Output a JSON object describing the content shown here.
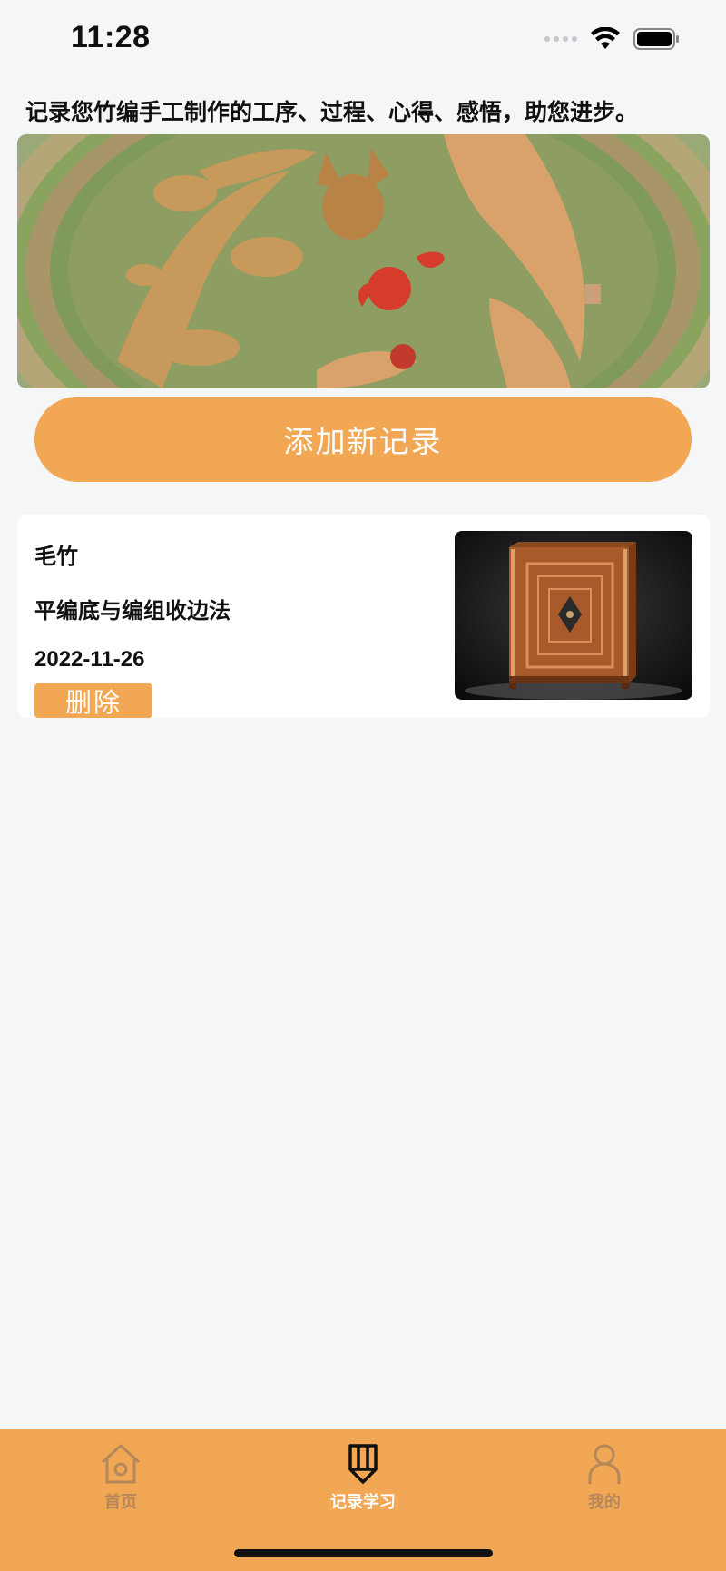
{
  "status_bar": {
    "time": "11:28"
  },
  "intro_text": "记录您竹编手工制作的工序、过程、心得、感悟，助您进步。",
  "banner": {
    "description_icon": "bamboo-dragon-phoenix-image"
  },
  "add_button_label": "添加新记录",
  "records": [
    {
      "material": "毛竹",
      "title": "平编底与编组收边法",
      "date": "2022-11-26",
      "delete_label": "删除",
      "thumbnail_icon": "bamboo-cabinet-image"
    }
  ],
  "tabs": [
    {
      "label": "首页",
      "icon": "home-icon",
      "active": false
    },
    {
      "label": "记录学习",
      "icon": "pencil-icon",
      "active": true
    },
    {
      "label": "我的",
      "icon": "person-icon",
      "active": false
    }
  ],
  "colors": {
    "accent": "#f1a753",
    "background": "#f5f6f8",
    "inactive_tab": "#b5875a"
  }
}
